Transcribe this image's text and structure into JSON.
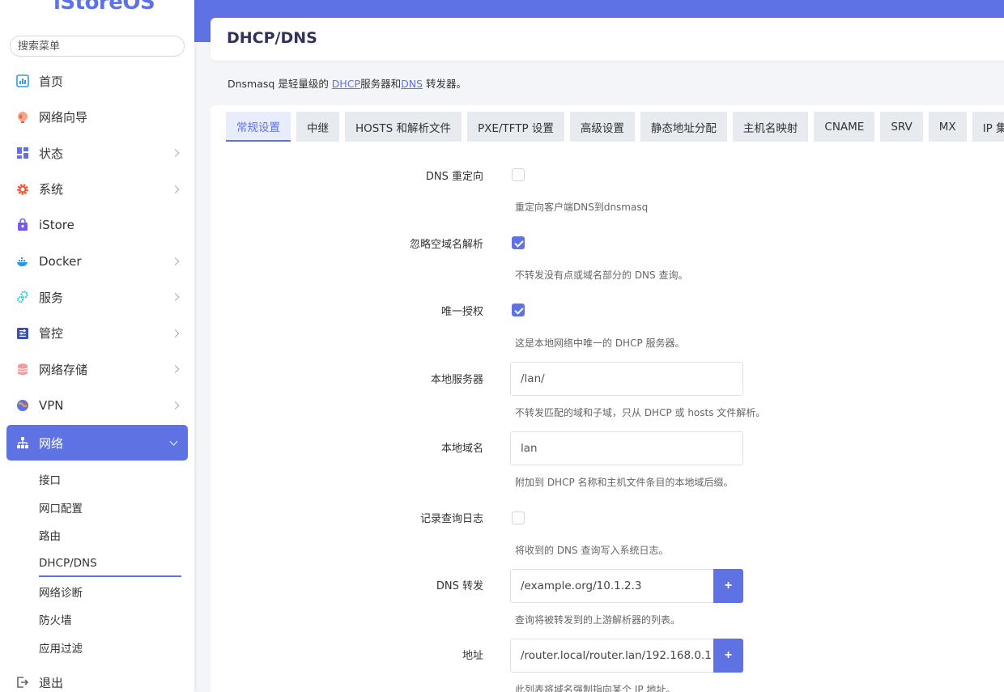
{
  "brand": {
    "logo": "iStoreOS"
  },
  "search": {
    "placeholder": "搜索菜单"
  },
  "nav": [
    {
      "label": "首页",
      "icon": "chart-icon",
      "chevron": false
    },
    {
      "label": "网络向导",
      "icon": "globe-icon",
      "chevron": false
    },
    {
      "label": "状态",
      "icon": "dashboard-icon",
      "chevron": true
    },
    {
      "label": "系统",
      "icon": "gear-icon",
      "chevron": true
    },
    {
      "label": "iStore",
      "icon": "bag-icon",
      "chevron": false
    },
    {
      "label": "Docker",
      "icon": "docker-icon",
      "chevron": true
    },
    {
      "label": "服务",
      "icon": "services-icon",
      "chevron": true
    },
    {
      "label": "管控",
      "icon": "sliders-icon",
      "chevron": true
    },
    {
      "label": "网络存储",
      "icon": "database-icon",
      "chevron": true
    },
    {
      "label": "VPN",
      "icon": "vpn-icon",
      "chevron": true
    },
    {
      "label": "网络",
      "icon": "network-icon",
      "chevron": true,
      "active": true
    }
  ],
  "subnav": [
    "接口",
    "网口配置",
    "路由",
    "DHCP/DNS",
    "网络诊断",
    "防火墙",
    "应用过滤"
  ],
  "subnav_current": "DHCP/DNS",
  "logout": {
    "label": "退出",
    "icon": "logout-icon"
  },
  "page": {
    "title": "DHCP/DNS",
    "desc_prefix": "Dnsmasq 是轻量级的 ",
    "desc_link1": "DHCP",
    "desc_mid": "服务器和",
    "desc_link2": "DNS",
    "desc_suffix": " 转发器。"
  },
  "tabs": [
    "常规设置",
    "中继",
    "HOSTS 和解析文件",
    "PXE/TFTP 设置",
    "高级设置",
    "静态地址分配",
    "主机名映射",
    "CNAME",
    "SRV",
    "MX",
    "IP 集"
  ],
  "active_tab": "常规设置",
  "form": {
    "dns_redirect": {
      "label": "DNS 重定向",
      "checked": false,
      "hint": "重定向客户端DNS到dnsmasq"
    },
    "domain_needed": {
      "label": "忽略空域名解析",
      "checked": true,
      "hint": "不转发没有点或域名部分的 DNS 查询。"
    },
    "authoritative": {
      "label": "唯一授权",
      "checked": true,
      "hint": "这是本地网络中唯一的 DHCP 服务器。"
    },
    "local_server": {
      "label": "本地服务器",
      "value": "/lan/",
      "hint": "不转发匹配的域和子域，只从 DHCP 或 hosts 文件解析。"
    },
    "local_domain": {
      "label": "本地域名",
      "value": "lan",
      "hint": "附加到 DHCP 名称和主机文件条目的本地域后缀。"
    },
    "log_queries": {
      "label": "记录查询日志",
      "checked": false,
      "hint": "将收到的 DNS 查询写入系统日志。"
    },
    "dns_forward": {
      "label": "DNS 转发",
      "placeholder": "/example.org/10.1.2.3",
      "button": "+",
      "hint": "查询将被转发到的上游解析器的列表。"
    },
    "address": {
      "label": "地址",
      "placeholder": "/router.local/router.lan/192.168.0.1",
      "button": "+",
      "hint": "此列表将域名强制指向某个 IP 地址。"
    }
  },
  "colors": {
    "accent": "#5e72e4"
  }
}
